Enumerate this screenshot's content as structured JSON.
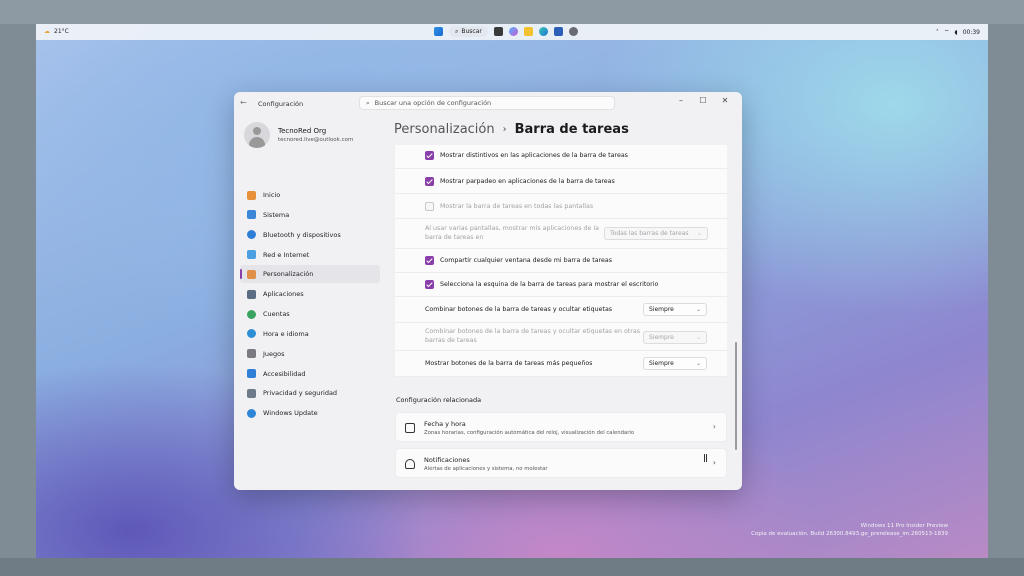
{
  "taskbar": {
    "weather": "21°C",
    "search_label": "Buscar",
    "time": "00:39"
  },
  "window": {
    "app_title": "Configuración",
    "search_placeholder": "Buscar una opción de configuración",
    "profile": {
      "name": "TecnoRed Org",
      "email": "tecnored.live@outlook.com"
    },
    "nav": [
      {
        "label": "Inicio",
        "icon": "home-icon",
        "color": "#e8913c"
      },
      {
        "label": "Sistema",
        "icon": "system-icon",
        "color": "#3b86d6"
      },
      {
        "label": "Bluetooth y dispositivos",
        "icon": "bluetooth-icon",
        "color": "#2f7fd6"
      },
      {
        "label": "Red e Internet",
        "icon": "wifi-icon",
        "color": "#4aa0e0"
      },
      {
        "label": "Personalización",
        "icon": "brush-icon",
        "color": "#e0904a",
        "active": true
      },
      {
        "label": "Aplicaciones",
        "icon": "apps-icon",
        "color": "#5b6d84"
      },
      {
        "label": "Cuentas",
        "icon": "account-icon",
        "color": "#3ba360"
      },
      {
        "label": "Hora e idioma",
        "icon": "globe-clock-icon",
        "color": "#2f8fd6"
      },
      {
        "label": "Juegos",
        "icon": "gamepad-icon",
        "color": "#7a7a80"
      },
      {
        "label": "Accesibilidad",
        "icon": "accessibility-icon",
        "color": "#2f7fd6"
      },
      {
        "label": "Privacidad y seguridad",
        "icon": "shield-icon",
        "color": "#6c7a8a"
      },
      {
        "label": "Windows Update",
        "icon": "update-icon",
        "color": "#2f86d6"
      }
    ],
    "breadcrumb": {
      "parent": "Personalización",
      "separator": "›",
      "current": "Barra de tareas"
    },
    "settings": {
      "badges": "Mostrar distintivos en las aplicaciones de la barra de tareas",
      "flashing": "Mostrar parpadeo en aplicaciones de la barra de tareas",
      "all_displays": "Mostrar la barra de tareas en todas las pantallas",
      "multi_display_line1": "Al usar varias pantallas, mostrar mis aplicaciones de la",
      "multi_display_line2": "barra de tareas en",
      "multi_display_value": "Todas las barras de tareas",
      "share_window": "Compartir cualquier ventana desde mi barra de tareas",
      "corner_desktop": "Selecciona la esquina de la barra de tareas para mostrar el escritorio",
      "combine": "Combinar botones de la barra de tareas y ocultar etiquetas",
      "combine_value": "Siempre",
      "combine_other_line1": "Combinar botones de la barra de tareas y ocultar etiquetas en otras",
      "combine_other_line2": "barras de tareas",
      "combine_other_value": "Siempre",
      "smaller_buttons": "Mostrar botones de la barra de tareas más pequeños",
      "smaller_value": "Siempre"
    },
    "related": {
      "title": "Configuración relacionada",
      "items": [
        {
          "title": "Fecha y hora",
          "subtitle": "Zonas horarias, configuración automática del reloj, visualización del calendario"
        },
        {
          "title": "Notificaciones",
          "subtitle": "Alertas de aplicaciones y sistema, no molestar"
        }
      ]
    }
  },
  "watermark": {
    "line1": "Windows 11 Pro Insider Preview",
    "line2": "Copia de evaluación. Build 26300.8493.ge_prerelease_im.260513-1839"
  },
  "accent_color": "#8a3ea8"
}
